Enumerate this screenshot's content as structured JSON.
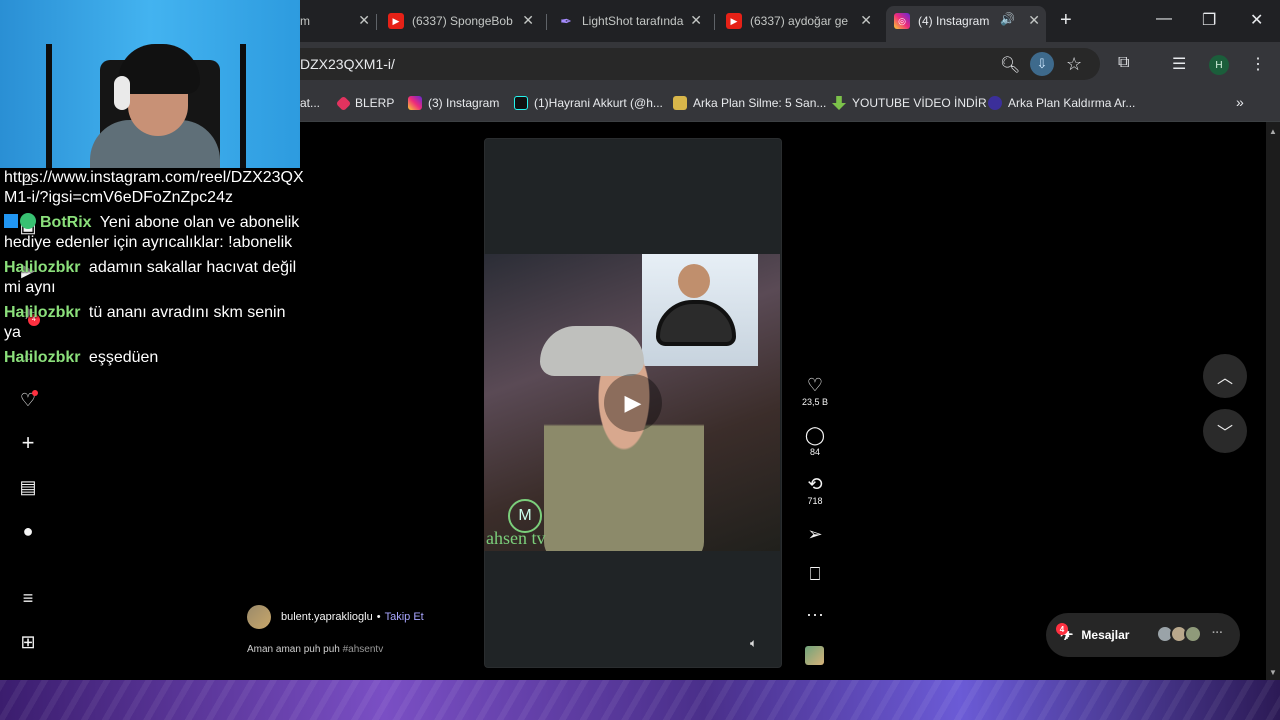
{
  "browser": {
    "tabs": [
      {
        "title": "m",
        "icon": "page-icon"
      },
      {
        "title": "(6337) SpongeBob",
        "icon": "youtube-icon"
      },
      {
        "title": "LightShot tarafında",
        "icon": "lightshot-feather-icon"
      },
      {
        "title": "(6337) aydoğar ge",
        "icon": "youtube-icon"
      },
      {
        "title": "(4) Instagram",
        "icon": "instagram-icon",
        "active": true
      }
    ],
    "url": "DZX23QXM1-i/",
    "profile_initial": "H",
    "bookmarks": [
      {
        "label": "at...",
        "icon": "generic-icon"
      },
      {
        "label": "BLERP",
        "icon": "blerp-icon"
      },
      {
        "label": "(3) Instagram",
        "icon": "instagram-icon"
      },
      {
        "label": "(1)Hayrani Akkurt (@h...",
        "icon": "tiktok-icon"
      },
      {
        "label": "Arka Plan Silme: 5 San...",
        "icon": "layers-icon"
      },
      {
        "label": "YOUTUBE VİDEO İNDİR",
        "icon": "download-arrow-icon"
      },
      {
        "label": "Arka Plan Kaldırma Ar...",
        "icon": "remover-icon"
      }
    ]
  },
  "chat": {
    "lines": [
      {
        "user": "",
        "text": "https://www.instagram.com/reel/DZX23QXM1-i/?igsi=cmV6eDFoZnZpc24z"
      },
      {
        "user": "BotRix",
        "text": "Yeni abone olan ve abonelik hediye edenler için ayrıcalıklar: !abonelik"
      },
      {
        "user": "Halilozbkr",
        "text": "adamın sakallar hacıvat değil mi aynı"
      },
      {
        "user": "Halilozbkr",
        "text": "tü ananı avradını skm senin ya"
      },
      {
        "user": "Halilozbkr",
        "text": "eşşedüen"
      }
    ]
  },
  "reel": {
    "author": "bulent.yapraklioglu",
    "separator": "•",
    "follow_label": "Takip Et",
    "caption": "Aman aman puh puh",
    "hashtag": "#ahsentv",
    "watermark": "ahsen tv",
    "watermark_logo": "M",
    "likes": "23,5 B",
    "comments": "84",
    "reposts": "718"
  },
  "messages": {
    "label": "Mesajlar",
    "badge": "4"
  },
  "sidebar": {
    "notification_badge": "4"
  },
  "colors": {
    "chat_username": "#8be07b",
    "follow_link": "#a8a6ff",
    "notification": "#ff3040",
    "tab_bar": "#202124",
    "toolbar": "#35363a"
  }
}
